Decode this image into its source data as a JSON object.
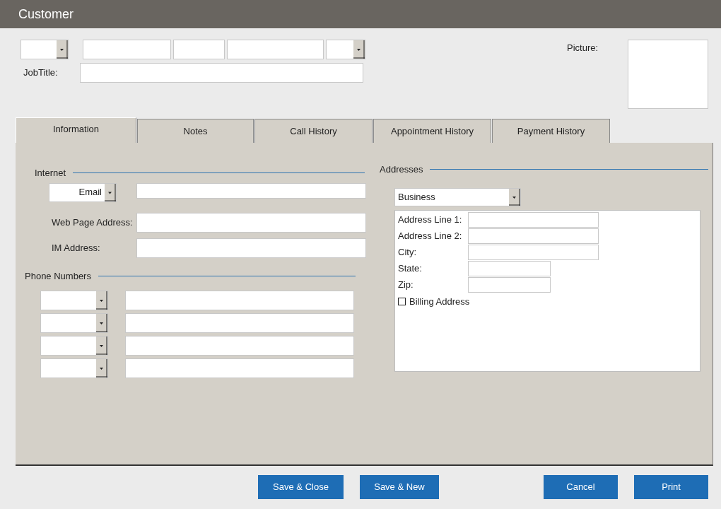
{
  "window": {
    "title": "Customer"
  },
  "name_row": [
    {
      "kind": "combo"
    },
    {
      "kind": "text"
    },
    {
      "kind": "text"
    },
    {
      "kind": "text"
    },
    {
      "kind": "combo"
    }
  ],
  "job_title": {
    "label": "JobTitle:"
  },
  "picture": {
    "label": "Picture:"
  },
  "tabs": [
    {
      "label": "Information",
      "selected": true
    },
    {
      "label": "Notes",
      "selected": false
    },
    {
      "label": "Call History",
      "selected": false
    },
    {
      "label": "Appointment History",
      "selected": false
    },
    {
      "label": "Payment History",
      "selected": false
    }
  ],
  "internet": {
    "title": "Internet",
    "email_type": "Email",
    "fields": [
      {
        "label": "Web Page Address:"
      },
      {
        "label": "IM Address:"
      }
    ]
  },
  "phone_numbers": {
    "title": "Phone Numbers",
    "rows": [
      {
        "kind": "phone"
      },
      {
        "kind": "phone"
      },
      {
        "kind": "phone"
      },
      {
        "kind": "phone"
      }
    ]
  },
  "addresses": {
    "title": "Addresses",
    "type": "Business",
    "fields": [
      {
        "label": "Address Line 1:",
        "kind": "long"
      },
      {
        "label": "Address Line 2:",
        "kind": "long"
      },
      {
        "label": "City:",
        "kind": "long"
      },
      {
        "label": "State:",
        "kind": "short"
      },
      {
        "label": "Zip:",
        "kind": "short"
      }
    ],
    "billing": {
      "label": "Billing Address",
      "checked": false
    }
  },
  "buttons": [
    {
      "label": "Save & Close"
    },
    {
      "label": "Save & New"
    },
    {
      "label": "Cancel"
    },
    {
      "label": "Print"
    }
  ]
}
